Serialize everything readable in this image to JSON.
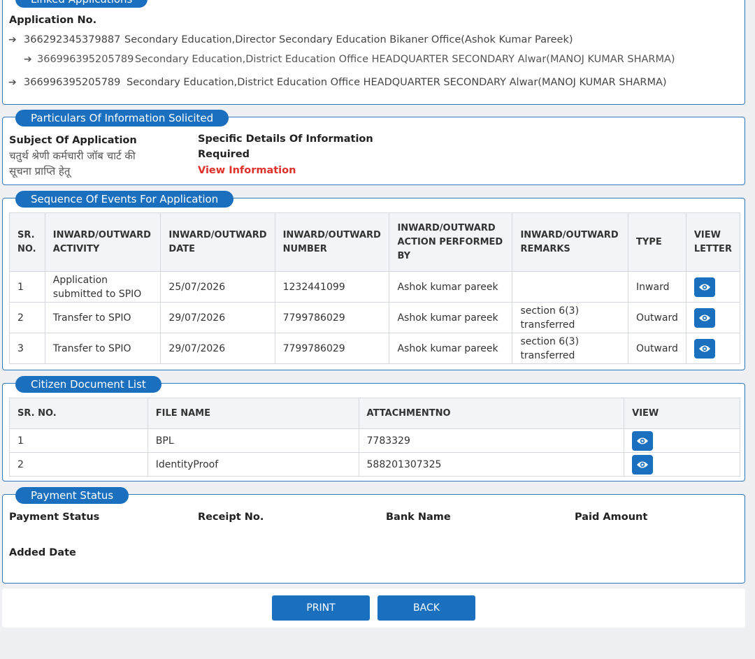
{
  "linked": {
    "legend": "Linked Applications",
    "app_no_label": "Application No.",
    "items": [
      {
        "number": "366292345379887",
        "desc": "Secondary Education,Director Secondary Education Bikaner Office(Ashok Kumar Pareek)"
      },
      {
        "number": "366996395205789",
        "desc": "Secondary Education,District Education Office HEADQUARTER SECONDARY Alwar(MANOJ KUMAR SHARMA)"
      },
      {
        "number": "366996395205789",
        "desc": "Secondary Education,District Education Office HEADQUARTER SECONDARY Alwar(MANOJ KUMAR SHARMA)"
      }
    ]
  },
  "particulars": {
    "legend": "Particulars Of Information Solicited",
    "subject_label": "Subject Of Application",
    "subject_line1": "चतुर्थ श्रेणी कर्मचारी जॉब चार्ट की",
    "subject_line2": "सूचना प्राप्ति हेतू",
    "details_label_line1": "Specific Details Of Information",
    "details_label_line2": "Required",
    "view_info_link": "View Information"
  },
  "events": {
    "legend": "Sequence Of Events For Application",
    "headers": [
      [
        "SR.",
        "NO."
      ],
      [
        "INWARD/OUTWARD",
        "ACTIVITY"
      ],
      [
        "INWARD/OUTWARD",
        "DATE"
      ],
      [
        "INWARD/OUTWARD",
        "NUMBER"
      ],
      [
        "INWARD/OUTWARD",
        "ACTION PERFORMED",
        "BY"
      ],
      [
        "INWARD/OUTWARD",
        "REMARKS"
      ],
      [
        "TYPE"
      ],
      [
        "VIEW",
        "LETTER"
      ]
    ],
    "rows": [
      {
        "sr": "1",
        "activity": [
          "Application",
          "submitted to SPIO"
        ],
        "date": "25/07/2026",
        "number": "1232441099",
        "by": "Ashok kumar pareek",
        "remarks": [
          "",
          ""
        ],
        "type": "Inward"
      },
      {
        "sr": "2",
        "activity": [
          "Transfer to SPIO",
          ""
        ],
        "date": "29/07/2026",
        "number": "7799786029",
        "by": "Ashok kumar pareek",
        "remarks": [
          "section 6(3)",
          "transferred"
        ],
        "type": "Outward"
      },
      {
        "sr": "3",
        "activity": [
          "Transfer to SPIO",
          ""
        ],
        "date": "29/07/2026",
        "number": "7799786029",
        "by": "Ashok kumar pareek",
        "remarks": [
          "section 6(3)",
          "transferred"
        ],
        "type": "Outward"
      }
    ]
  },
  "documents": {
    "legend": "Citizen Document List",
    "headers": [
      "SR. NO.",
      "FILE NAME",
      "ATTACHMENTNO",
      "VIEW"
    ],
    "rows": [
      {
        "sr": "1",
        "file": "BPL",
        "attachment": "7783329"
      },
      {
        "sr": "2",
        "file": "IdentityProof",
        "attachment": "588201307325"
      }
    ]
  },
  "payment": {
    "legend": "Payment Status",
    "status_label": "Payment Status",
    "receipt_label": "Receipt No.",
    "bank_label": "Bank Name",
    "amount_label": "Paid Amount",
    "date_label": "Added Date"
  },
  "actions": {
    "print_label": "PRINT",
    "back_label": "BACK"
  },
  "colors": {
    "accent": "#1a6fbe",
    "link_red": "#e0302a",
    "border": "#2f79bd"
  },
  "icons": {
    "arrow": "arrow-right-icon",
    "eye": "eye-icon"
  }
}
